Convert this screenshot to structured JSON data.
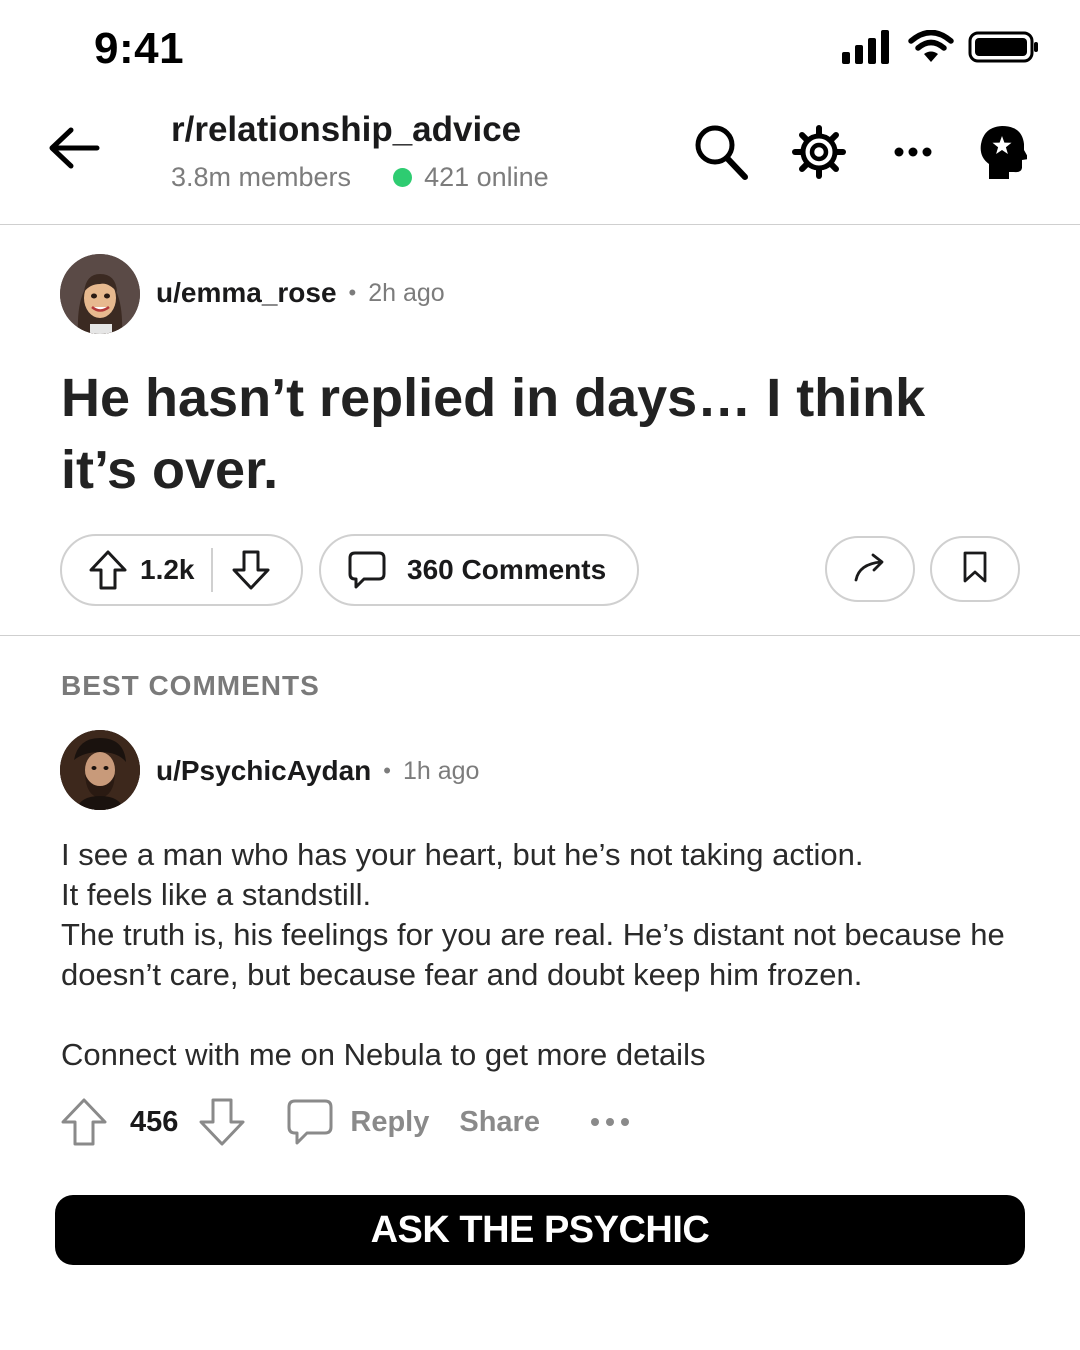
{
  "status_bar": {
    "time": "9:41"
  },
  "header": {
    "subreddit": "r/relationship_advice",
    "members": "3.8m members",
    "online": "421 online"
  },
  "post": {
    "author": "u/emma_rose",
    "time": "2h ago",
    "title": "He hasn’t replied in days… I think it’s over.",
    "upvotes": "1.2k",
    "comments_label": "360 Comments"
  },
  "comments": {
    "section_label": "BEST COMMENTS",
    "items": [
      {
        "author": "u/PsychicAydan",
        "time": "1h ago",
        "lines": [
          "I see a man who has your heart, but he’s not taking action.",
          "It feels like a standstill.",
          "The truth is, his feelings for you are real. He’s distant not because he doesn’t care, but because fear and doubt keep him frozen.",
          "Connect with me on Nebula to get more details"
        ],
        "score": "456",
        "reply_label": "Reply",
        "share_label": "Share"
      }
    ]
  },
  "cta": {
    "label": "ASK THE PSYCHIC"
  },
  "colors": {
    "online_dot": "#2ecc71",
    "cta_bg": "#000000"
  },
  "icons": [
    "signal-icon",
    "wifi-icon",
    "battery-icon",
    "back-arrow-icon",
    "search-icon",
    "gear-icon",
    "more-icon",
    "psychic-head-icon",
    "upvote-icon",
    "downvote-icon",
    "comment-icon",
    "share-icon",
    "bookmark-icon"
  ]
}
